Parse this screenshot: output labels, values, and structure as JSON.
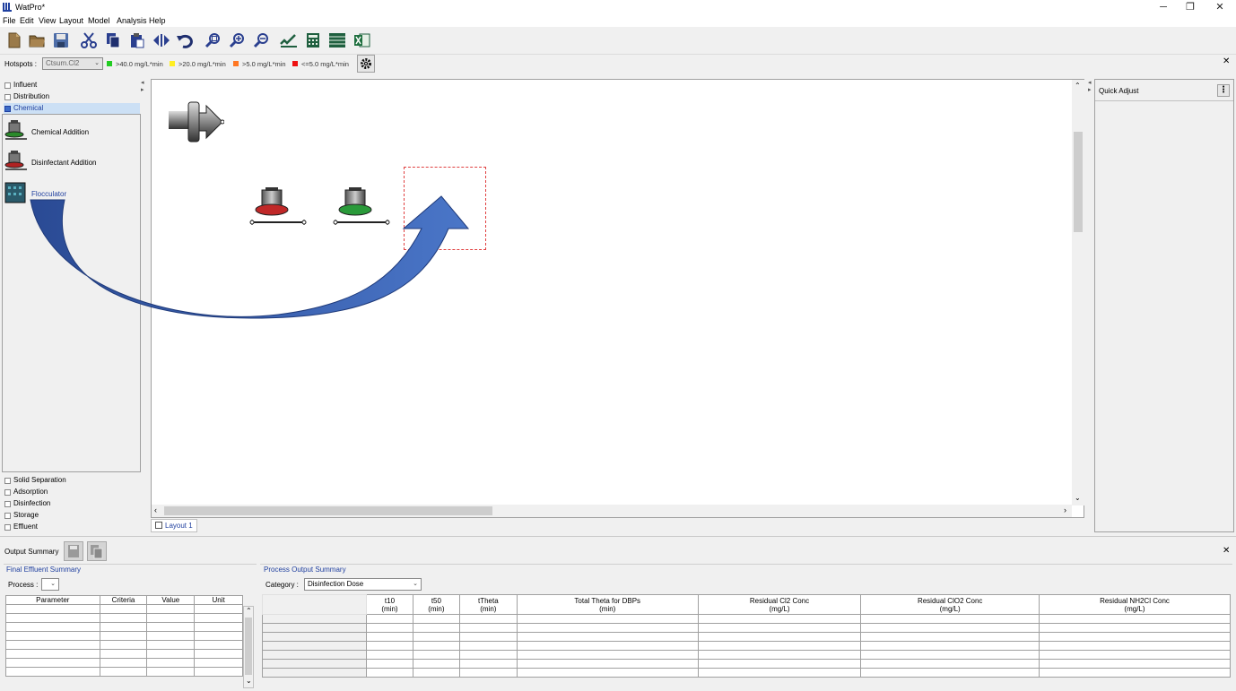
{
  "window": {
    "title": "WatPro*",
    "controls": {
      "minimize": "─",
      "restore": "❐",
      "close": "✕"
    }
  },
  "menu": [
    "File",
    "Edit",
    "View",
    "Layout",
    "Model",
    "Analysis",
    "Help"
  ],
  "toolbar": {
    "icons": [
      "new-file-icon",
      "open-folder-icon",
      "save-icon",
      "cut-icon",
      "copy-icon",
      "paste-icon",
      "flip-icon",
      "undo-icon",
      "zoom-fit-icon",
      "zoom-in-icon",
      "zoom-out-icon",
      "chart-check-icon",
      "calculator-icon",
      "table-icon",
      "excel-export-icon"
    ]
  },
  "hotspots": {
    "label": "Hotspots :",
    "selected": "Ctsum.Cl2",
    "legend": [
      {
        "color": "#22cc22",
        "text": ">40.0 mg/L*min"
      },
      {
        "color": "#ffee22",
        "text": ">20.0 mg/L*min"
      },
      {
        "color": "#ff7722",
        "text": ">5.0 mg/L*min"
      },
      {
        "color": "#ee1111",
        "text": "<=5.0 mg/L*min"
      }
    ],
    "close": "✕"
  },
  "sidebar": {
    "top_categories": [
      "Influent",
      "Distribution",
      "Chemical"
    ],
    "selected": "Chemical",
    "items": [
      "Chemical Addition",
      "Disinfectant Addition",
      "Flocculator"
    ],
    "bottom_categories": [
      "Solid Separation",
      "Adsorption",
      "Disinfection",
      "Storage",
      "Effluent"
    ]
  },
  "canvas": {
    "tab_label": "Layout 1"
  },
  "quick_adjust": {
    "title": "Quick Adjust",
    "menu": "⋮"
  },
  "output": {
    "title": "Output Summary",
    "close": "✕",
    "final": {
      "title": "Final Effluent Summary",
      "process_label": "Process :",
      "headers": [
        "Parameter",
        "Criteria",
        "Value",
        "Unit"
      ]
    },
    "process": {
      "title": "Process Output Summary",
      "category_label": "Category :",
      "category_value": "Disinfection Dose",
      "headers": [
        [
          "t10",
          "(min)"
        ],
        [
          "t50",
          "(min)"
        ],
        [
          "tTheta",
          "(min)"
        ],
        [
          "Total Theta for DBPs",
          "(min)"
        ],
        [
          "Residual Cl2 Conc",
          "(mg/L)"
        ],
        [
          "Residual ClO2 Conc",
          "(mg/L)"
        ],
        [
          "Residual NH2Cl Conc",
          "(mg/L)"
        ]
      ]
    }
  },
  "colors": {
    "accent": "#3c6cc8",
    "arrow": "#3a63b6",
    "selection": "#cce0f5",
    "drop_target": "#e04040"
  }
}
